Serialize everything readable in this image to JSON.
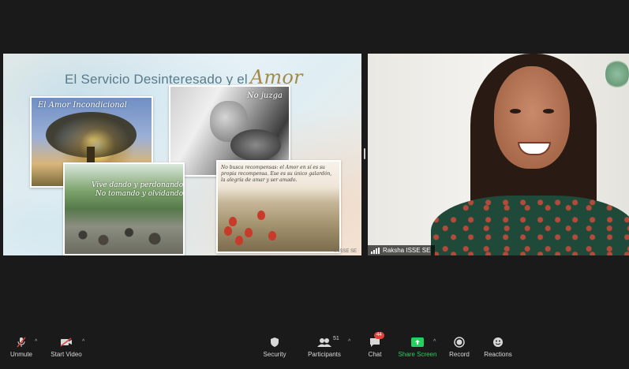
{
  "slide": {
    "title_main": "El Servicio Desinteresado y el",
    "title_emphasis": "Amor",
    "captions": {
      "tree": "El Amor Incondicional",
      "mother": "No juzga",
      "river_line1": "Vive dando y perdonando",
      "river_line2": "No tomando y olvidando",
      "flowers": "No busca recompensas: el Amor en sí es su propia recompensa. Ese es su único galardón, la alegría de amar y ser amado."
    },
    "copyright": "© ISSE SE"
  },
  "participant": {
    "name": "Raksha ISSE SE"
  },
  "toolbar": {
    "unmute": "Unmute",
    "start_video": "Start Video",
    "security": "Security",
    "participants": "Participants",
    "participants_count": "51",
    "chat": "Chat",
    "chat_badge": "44",
    "share_screen": "Share Screen",
    "record": "Record",
    "reactions": "Reactions"
  },
  "colors": {
    "share_screen_accent": "#23d160",
    "badge": "#e0413a",
    "mute_slash": "#e0413a"
  },
  "icons": [
    "microphone-muted-icon",
    "video-off-icon",
    "shield-icon",
    "participants-icon",
    "chat-icon",
    "share-screen-icon",
    "record-icon",
    "reactions-icon",
    "signal-bars-icon"
  ]
}
